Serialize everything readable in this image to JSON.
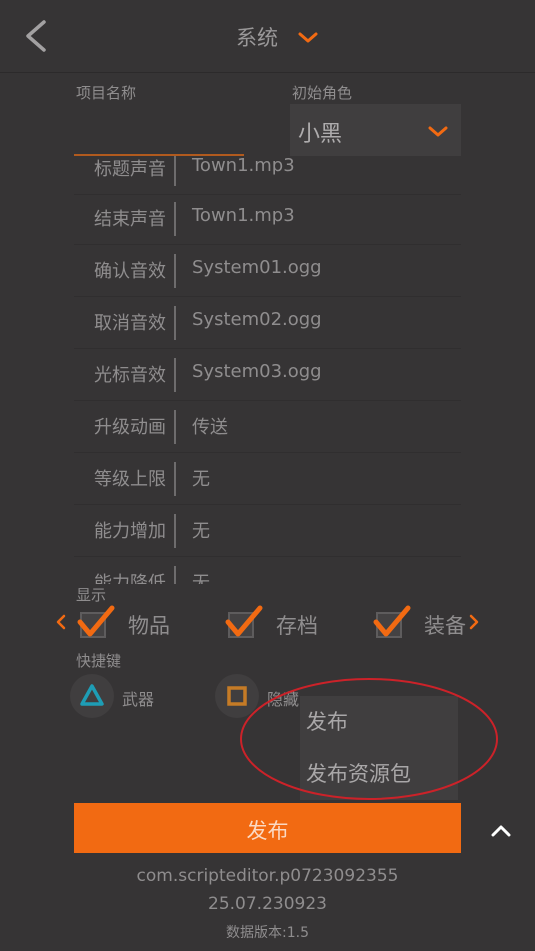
{
  "header": {
    "title": "系统"
  },
  "form": {
    "project_name_label": "项目名称",
    "project_name_value": "",
    "initial_role_label": "初始角色",
    "initial_role_value": "小黑"
  },
  "settings_rows": [
    {
      "key": "标题声音",
      "value": "Town1.mp3"
    },
    {
      "key": "结束声音",
      "value": "Town1.mp3"
    },
    {
      "key": "确认音效",
      "value": "System01.ogg"
    },
    {
      "key": "取消音效",
      "value": "System02.ogg"
    },
    {
      "key": "光标音效",
      "value": "System03.ogg"
    },
    {
      "key": "升级动画",
      "value": "传送"
    },
    {
      "key": "等级上限",
      "value": "无"
    },
    {
      "key": "能力增加",
      "value": "无"
    },
    {
      "key": "能力降低",
      "value": "无"
    }
  ],
  "display": {
    "label": "显示",
    "options": [
      {
        "label": "物品",
        "checked": true
      },
      {
        "label": "存档",
        "checked": true
      },
      {
        "label": "装备",
        "checked": true
      }
    ]
  },
  "shortcuts": {
    "label": "快捷键",
    "items": [
      {
        "label": "武器",
        "icon": "triangle-icon",
        "color": "#1e9db5"
      },
      {
        "label": "隐藏",
        "icon": "square-icon",
        "color": "#c57b26"
      }
    ]
  },
  "publish_menu": {
    "items": [
      "发布",
      "发布资源包"
    ]
  },
  "publish_button": {
    "label": "发布"
  },
  "footer": {
    "package": "com.scripteditor.p0723092355",
    "version": "25.07.230923",
    "data_version": "数据版本:1.5"
  },
  "colors": {
    "accent": "#f26a12",
    "background": "#363435",
    "annotation": "#cc2229"
  }
}
